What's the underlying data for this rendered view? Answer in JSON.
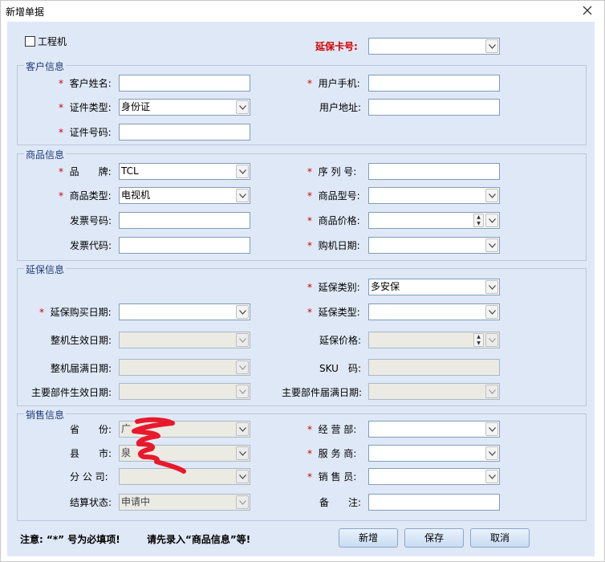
{
  "window": {
    "title": "新增单据",
    "close_glyph": "X"
  },
  "top": {
    "checkbox_label": "工程机",
    "warranty_card_label": "延保卡号:",
    "warranty_card_value": ""
  },
  "customer": {
    "group_title": "客户信息",
    "name_label": "客户姓名:",
    "phone_label": "用户手机:",
    "id_type_label": "证件类型:",
    "id_type_value": "身份证",
    "address_label": "用户地址:",
    "id_number_label": "证件号码:"
  },
  "product": {
    "group_title": "商品信息",
    "brand_label": "品　　牌:",
    "brand_value": "TCL",
    "serial_label": "序 列 号:",
    "category_label": "商品类型:",
    "category_value": "电视机",
    "model_label": "商品型号:",
    "invoice_no_label": "发票号码:",
    "price_label": "商品价格:",
    "invoice_code_label": "发票代码:",
    "purchase_date_label": "购机日期:"
  },
  "warranty": {
    "group_title": "延保信息",
    "category_label": "延保类别:",
    "category_value": "多安保",
    "buy_date_label": "延保购买日期:",
    "type_label": "延保类型:",
    "effective_label": "整机生效日期:",
    "price_label": "延保价格:",
    "expire_label": "整机届满日期:",
    "sku_label": "SKU　码:",
    "parts_effective_label": "主要部件生效日期:",
    "parts_expire_label": "主要部件届满日期:"
  },
  "sales": {
    "group_title": "销售信息",
    "province_label": "省　　份:",
    "province_value": "广",
    "dept_label": "经 营 部:",
    "county_label": "县　　市:",
    "county_value": "泉",
    "provider_label": "服 务 商:",
    "branch_label": "分 公 司:",
    "seller_label": "销 售 员:",
    "settle_label": "结算状态:",
    "settle_value": "申请中",
    "remark_label": "备　　注:"
  },
  "footer": {
    "note1": "注意: “*” 号为必填项!",
    "note2": "请先录入“商品信息”等!",
    "new_label": "新增",
    "save_label": "保存",
    "cancel_label": "取消"
  },
  "colors": {
    "client_bg": "#dfe8f6",
    "required": "#d00000",
    "group_title": "#1f3b7c"
  },
  "icons": {
    "dropdown": "chevron-down-icon",
    "spinner": "spinner-icon",
    "close": "close-icon"
  }
}
